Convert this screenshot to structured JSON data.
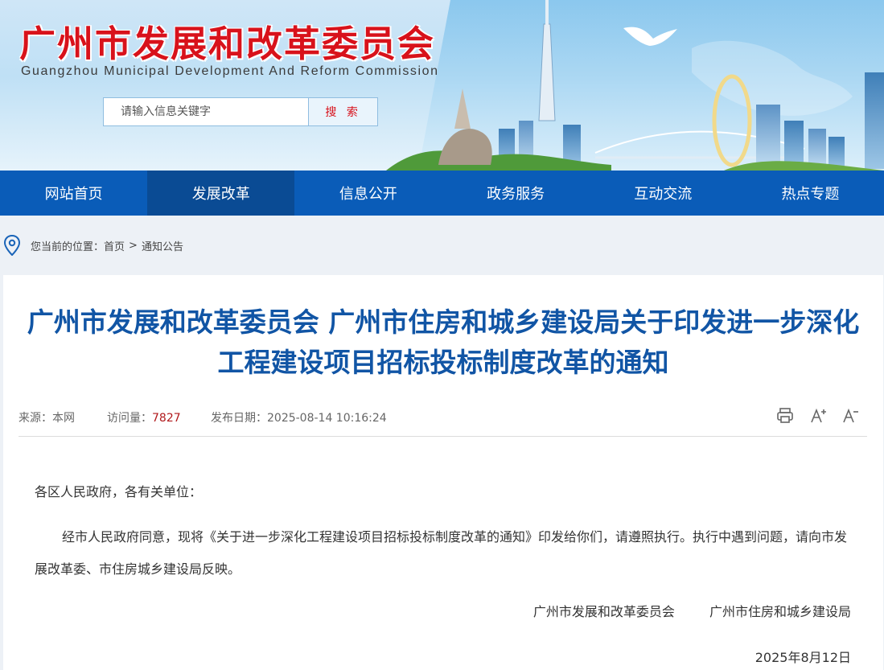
{
  "header": {
    "title": "广州市发展和改革委员会",
    "subtitle": "Guangzhou Municipal Development And Reform Commission",
    "search": {
      "placeholder": "请输入信息关键字",
      "button_label": "搜 索"
    }
  },
  "nav": {
    "items": [
      {
        "label": "网站首页"
      },
      {
        "label": "发展改革",
        "active": true
      },
      {
        "label": "信息公开"
      },
      {
        "label": "政务服务"
      },
      {
        "label": "互动交流"
      },
      {
        "label": "热点专题"
      }
    ]
  },
  "breadcrumb": {
    "prefix": "您当前的位置：",
    "items": [
      "首页",
      "通知公告"
    ],
    "separator": ">"
  },
  "article": {
    "title": "广州市发展和改革委员会 广州市住房和城乡建设局关于印发进一步深化工程建设项目招标投标制度改革的通知",
    "meta": {
      "source_label": "来源：",
      "source": "本网",
      "views_label": "访问量：",
      "views": "7827",
      "date_label": "发布日期：",
      "date": "2025-08-14 10:16:24"
    },
    "tools": [
      "print-icon",
      "font-increase-icon",
      "font-decrease-icon"
    ],
    "salutation": "各区人民政府，各有关单位：",
    "paragraph": "经市人民政府同意，现将《关于进一步深化工程建设项目招标投标制度改革的通知》印发给你们，请遵照执行。执行中遇到问题，请向市发展改革委、市住房城乡建设局反映。",
    "signatures": [
      "广州市发展和改革委员会",
      "广州市住房和城乡建设局"
    ],
    "sign_date": "2025年8月12日"
  },
  "colors": {
    "nav_bg": "#0a5cb8",
    "nav_active": "#0a4b94",
    "title_red": "#d8121b",
    "article_title_blue": "#1155a5",
    "views_red": "#b1191c",
    "page_bg": "#edf1f6"
  }
}
